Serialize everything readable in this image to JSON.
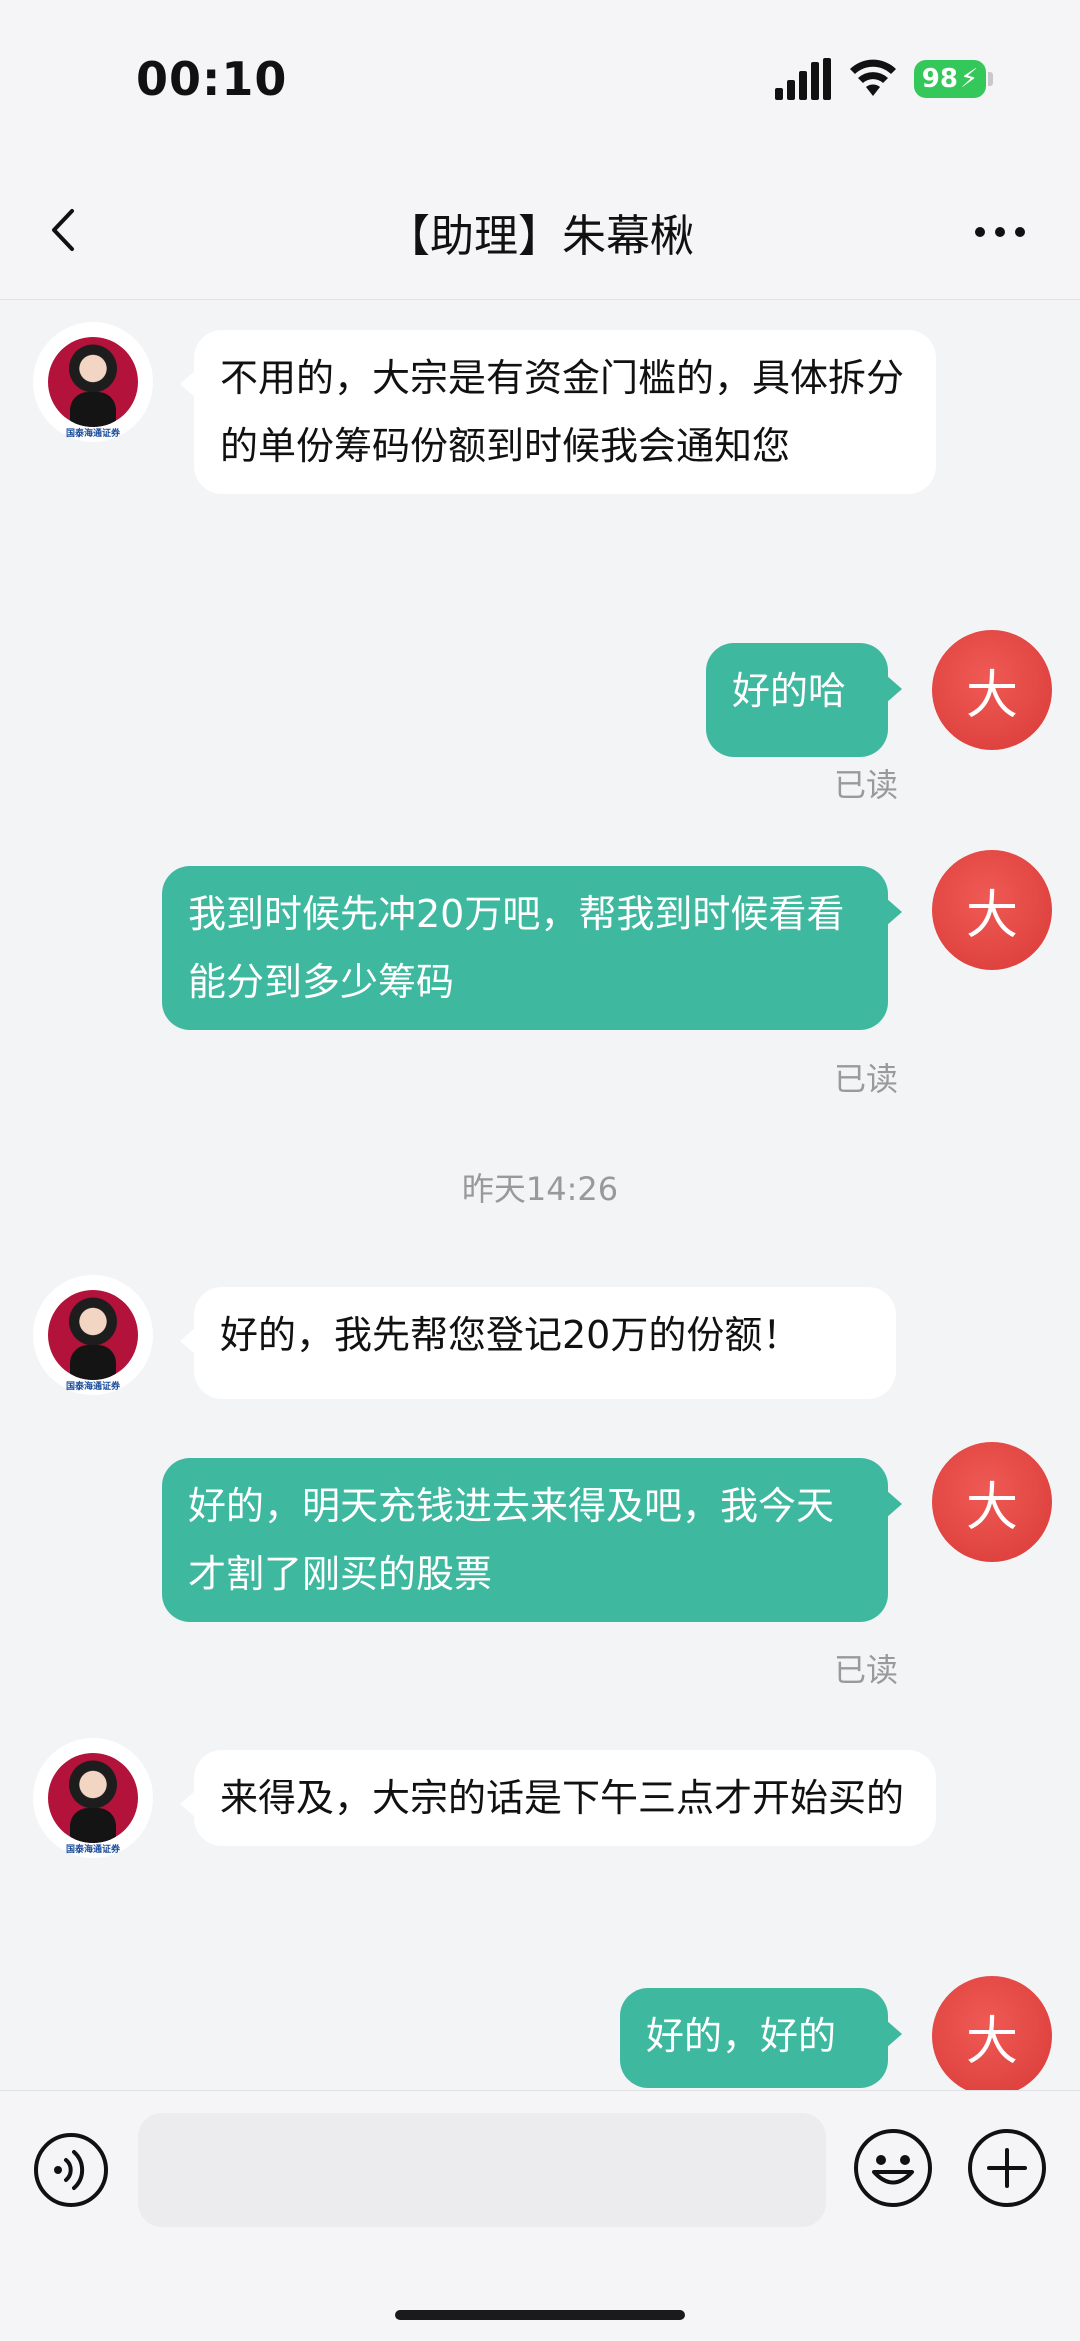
{
  "status_bar": {
    "time": "00:10",
    "battery": "98",
    "battery_color": "#34c759"
  },
  "header": {
    "title": "【助理】朱幕楸",
    "back_icon": "chevron-left-icon",
    "more_icon": "more-horizontal-icon"
  },
  "avatars": {
    "assistant_logo": "国泰海通证券",
    "user_initial": "大"
  },
  "messages": [
    {
      "side": "left",
      "text": "不用的，大宗是有资金门槛的，具体拆分的单份筹码份额到时候我会通知您"
    },
    {
      "side": "right",
      "text": "好的哈",
      "status": "已读"
    },
    {
      "side": "right",
      "text": "我到时候先冲20万吧，帮我到时候看看能分到多少筹码",
      "status": "已读"
    },
    {
      "timestamp": "昨天14:26"
    },
    {
      "side": "left",
      "text": "好的，我先帮您登记20万的份额！"
    },
    {
      "side": "right",
      "text": "好的，明天充钱进去来得及吧，我今天才割了刚买的股票",
      "status": "已读"
    },
    {
      "side": "left",
      "text": "来得及，大宗的话是下午三点才开始买的"
    },
    {
      "side": "right",
      "text": "好的，好的"
    }
  ],
  "colors": {
    "outgoing_bubble": "#3fb8a0",
    "incoming_bubble": "#ffffff",
    "user_avatar": "#e0433f",
    "background": "#f3f4f6"
  },
  "input_bar": {
    "placeholder": "",
    "voice_icon": "voice-icon",
    "emoji_icon": "emoji-icon",
    "plus_icon": "plus-circle-icon"
  }
}
